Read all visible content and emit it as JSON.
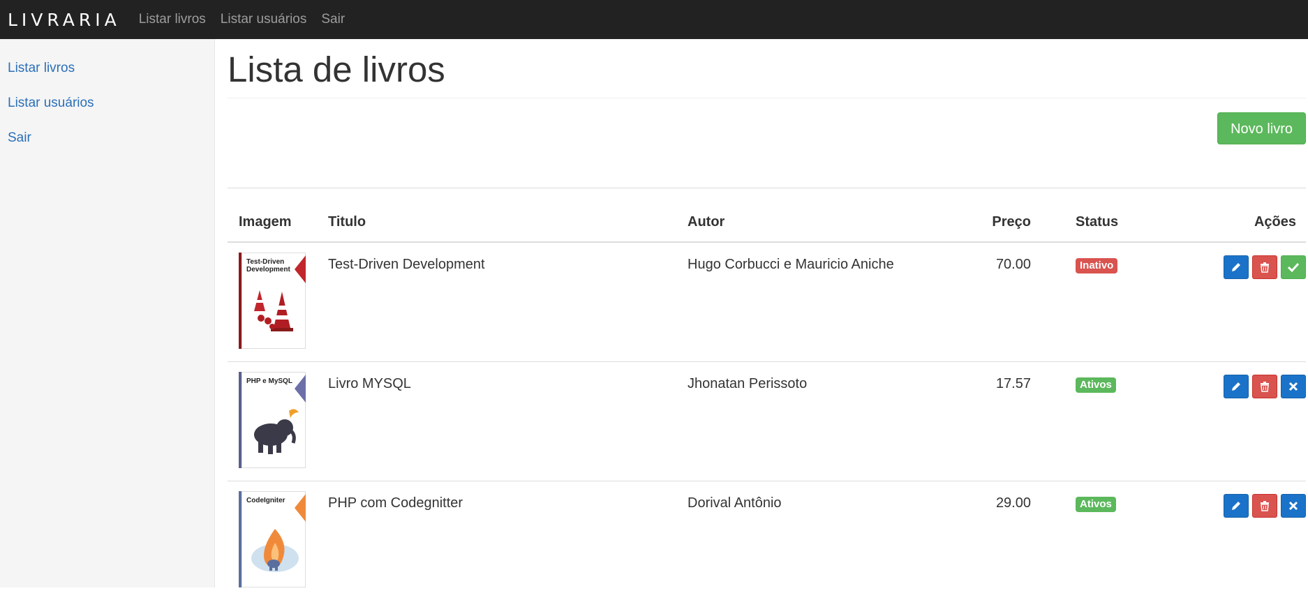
{
  "navbar": {
    "brand": "LIVRARIA",
    "links": [
      "Listar livros",
      "Listar usuários",
      "Sair"
    ]
  },
  "sidebar": {
    "items": [
      {
        "label": "Listar livros"
      },
      {
        "label": "Listar usuários"
      },
      {
        "label": "Sair"
      }
    ]
  },
  "page": {
    "title": "Lista de livros",
    "new_button": "Novo livro"
  },
  "table": {
    "headers": {
      "image": "Imagem",
      "title": "Titulo",
      "author": "Autor",
      "price": "Preço",
      "status": "Status",
      "actions": "Ações"
    },
    "rows": [
      {
        "title": "Test-Driven Development",
        "author": "Hugo Corbucci e Mauricio Aniche",
        "price": "70.00",
        "status": "Inativo",
        "cover_text": "Test-Driven Development",
        "toggle_icon": "check-icon"
      },
      {
        "title": "Livro MYSQL",
        "author": "Jhonatan Perissoto",
        "price": "17.57",
        "status": "Ativos",
        "cover_text": "PHP e MySQL",
        "toggle_icon": "x-icon"
      },
      {
        "title": "PHP com Codegnitter",
        "author": "Dorival Antônio",
        "price": "29.00",
        "status": "Ativos",
        "cover_text": "CodeIgniter",
        "toggle_icon": "x-icon"
      }
    ]
  },
  "colors": {
    "navbar_bg": "#222222",
    "link": "#2a6fb8",
    "success": "#5cb85c",
    "danger": "#d9534f",
    "primary": "#1a73c9"
  }
}
